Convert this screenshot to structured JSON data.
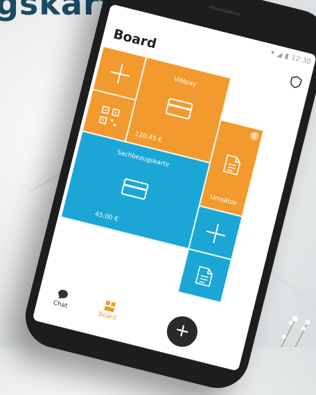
{
  "headline": "gskarte",
  "status_time": "12:30",
  "board_title": "Board",
  "tiles": {
    "vimpay": {
      "label": "VIMpay",
      "amount": "120,45 €"
    },
    "sachbezug": {
      "label": "Sachbezugskarte",
      "amount": "45,00 €"
    },
    "umsaetze": {
      "label": "Umsätze",
      "badge": "1"
    }
  },
  "nav": {
    "chat_label": "Chat",
    "board_label": "Board"
  },
  "fab_label": "+",
  "colors": {
    "orange": "#f29a2e",
    "blue": "#1ba6d6",
    "headline": "#1b4a63"
  }
}
